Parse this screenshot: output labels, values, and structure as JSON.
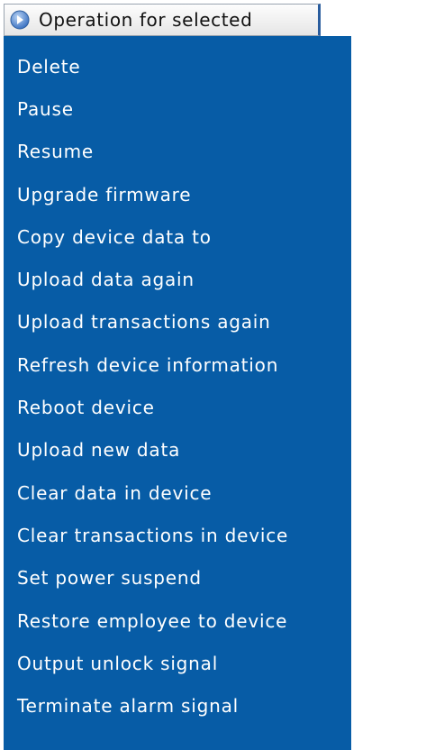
{
  "operation_button": {
    "label": "Operation for selected",
    "icon": "circle-arrow-right-icon"
  },
  "menu": {
    "items": [
      {
        "label": "Delete"
      },
      {
        "label": "Pause"
      },
      {
        "label": "Resume"
      },
      {
        "label": "Upgrade firmware"
      },
      {
        "label": "Copy device data to"
      },
      {
        "label": "Upload data again"
      },
      {
        "label": "Upload transactions again"
      },
      {
        "label": "Refresh device information"
      },
      {
        "label": "Reboot device"
      },
      {
        "label": "Upload new data"
      },
      {
        "label": "Clear data in device"
      },
      {
        "label": "Clear transactions in device"
      },
      {
        "label": "Set power suspend"
      },
      {
        "label": "Restore employee to device"
      },
      {
        "label": "Output unlock signal"
      },
      {
        "label": "Terminate alarm signal"
      }
    ]
  },
  "colors": {
    "menu_background": "#075ca6",
    "menu_text": "#ffffff",
    "icon_fill": "#5b8fd6"
  }
}
